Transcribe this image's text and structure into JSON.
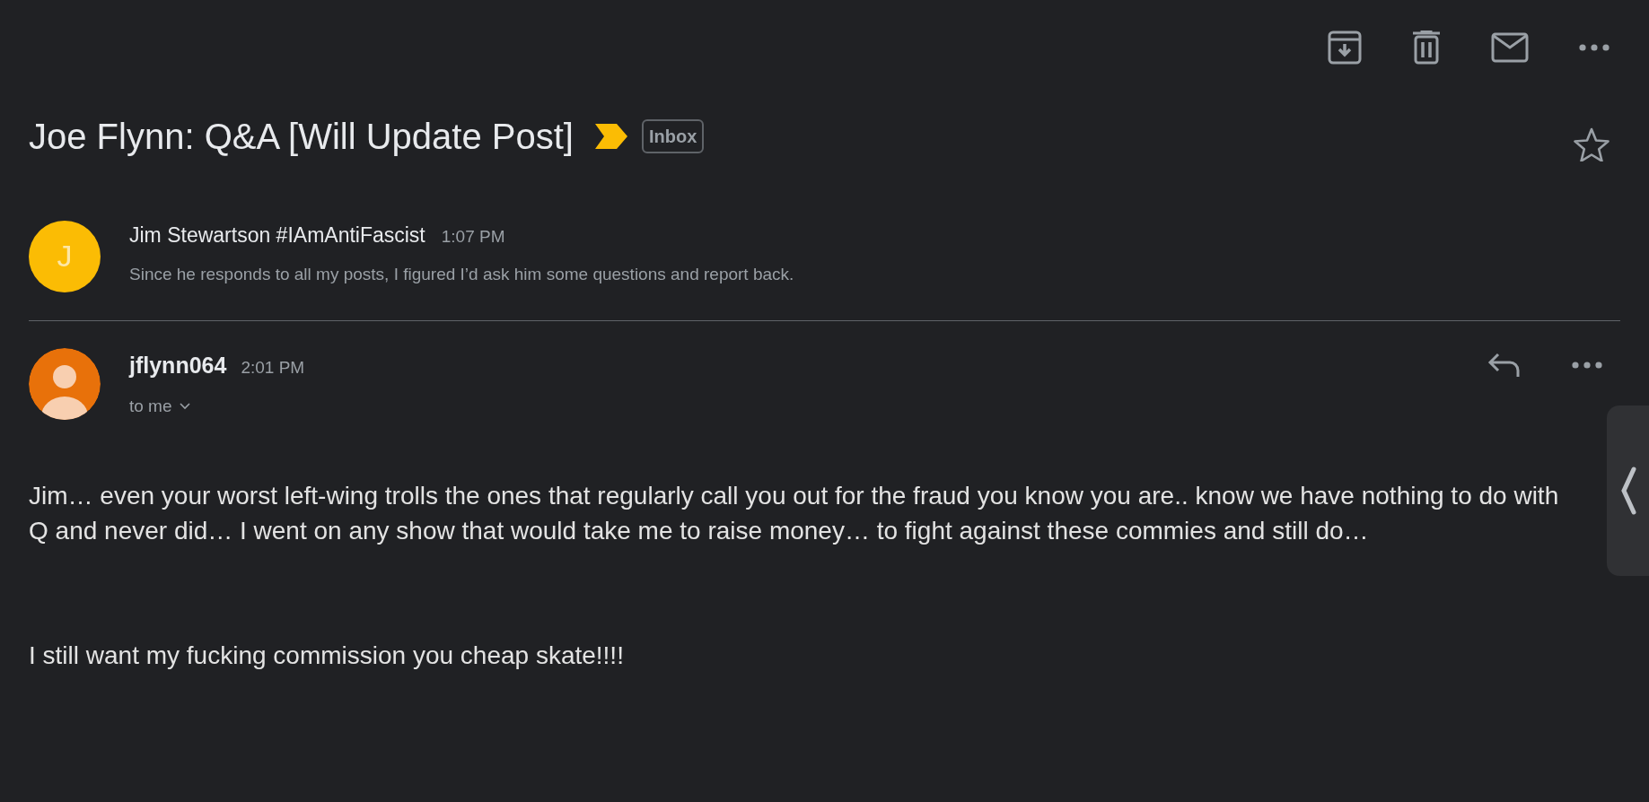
{
  "thread": {
    "subject": "Joe Flynn: Q&A [Will Update Post]",
    "important": true,
    "label": "Inbox",
    "starred": false
  },
  "messages": [
    {
      "kind": "collapsed",
      "avatar_letter": "J",
      "color": "#fbbc04",
      "sender": "Jim Stewartson #IAmAntiFascist",
      "time": "1:07 PM",
      "snippet": "Since he responds to all my posts, I figured I’d ask him some questions and report back."
    },
    {
      "kind": "expanded",
      "color": "#e8710a",
      "sender": "jflynn064",
      "time": "2:01 PM",
      "recipient": "to me",
      "body": [
        "Jim… even your worst left-wing trolls the ones that regularly call you out for the fraud you know you are.. know we have nothing to do with Q and never did… I went on any show that would take me to raise money… to fight against these commies and still do…",
        "I still want my fucking commission you cheap skate!!!!"
      ]
    }
  ]
}
